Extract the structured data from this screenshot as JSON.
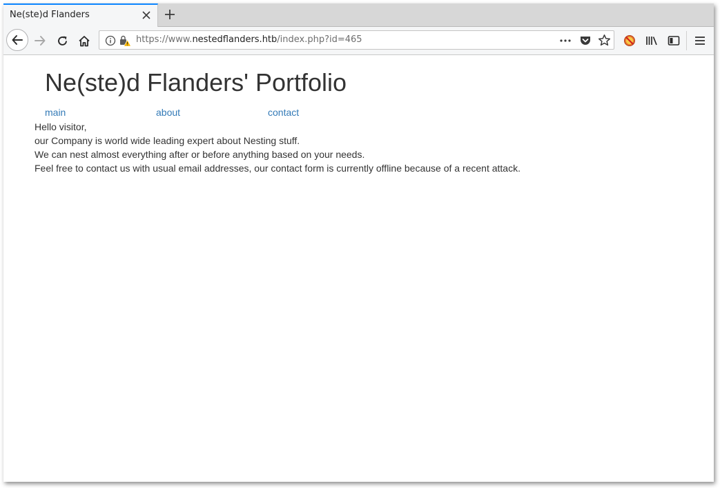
{
  "browser": {
    "tab": {
      "title": "Ne(ste)d Flanders"
    },
    "address": {
      "scheme_prefix": "https://www.",
      "host": "nestedflanders.htb",
      "path": "/index.php?id=465"
    }
  },
  "page": {
    "title": "Ne(ste)d Flanders' Portfolio",
    "nav": [
      "main",
      "about",
      "contact"
    ],
    "paragraphs": [
      "Hello visitor,",
      "our Company is world wide leading expert about Nesting stuff.",
      "We can nest almost everything after or before anything based on your needs.",
      "Feel free to contact us with usual email addresses, our contact form is currently offline because of a recent attack."
    ]
  },
  "colors": {
    "link": "#337ab7",
    "tab_accent": "#0a84ff",
    "text": "#333333"
  },
  "icons": [
    "close-icon",
    "plus-icon",
    "back-arrow-icon",
    "forward-arrow-icon",
    "reload-icon",
    "home-icon",
    "info-icon",
    "insecure-lock-icon",
    "more-dots-icon",
    "pocket-icon",
    "star-icon",
    "blocked-extension-icon",
    "library-icon",
    "sidebar-icon",
    "hamburger-menu-icon"
  ]
}
